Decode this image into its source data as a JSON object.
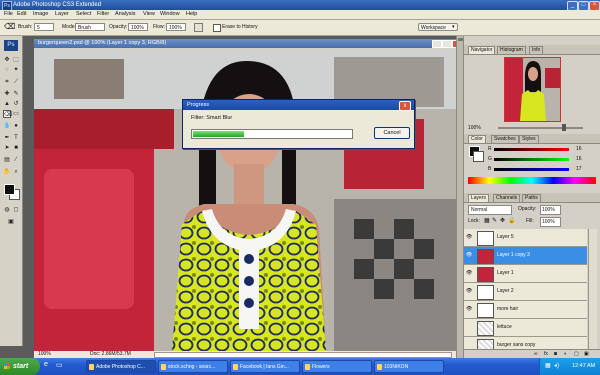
{
  "window": {
    "app_icon": "Ps",
    "title": "Adobe Photoshop CS3 Extended",
    "controls": [
      "_",
      "□",
      "×"
    ]
  },
  "menu": [
    "File",
    "Edit",
    "Image",
    "Layer",
    "Select",
    "Filter",
    "Analysis",
    "View",
    "Window",
    "Help"
  ],
  "options": {
    "brush_label": "Brush:",
    "brush_size": "5",
    "mode_label": "Mode:",
    "mode_value": "Brush",
    "opacity_label": "Opacity:",
    "opacity_value": "100%",
    "flow_label": "Flow:",
    "flow_value": "100%",
    "erase_history_label": "Erase to History",
    "workspace_label": "Workspace"
  },
  "toolbox": {
    "logo": "Ps"
  },
  "document": {
    "title": "burgerqueen2.psd @ 100% (Layer 1 copy 3, RGB/8)",
    "zoom": "100%",
    "doc_size": "Doc: 2.86M/53.7M"
  },
  "progress_dialog": {
    "title": "Progress",
    "label": "Filter: Smart Blur",
    "progress": 0.32,
    "cancel_label": "Cancel",
    "close_glyph": "x"
  },
  "navigator": {
    "tabs": [
      "Navigator",
      "Histogram",
      "Info"
    ],
    "zoom": "100%"
  },
  "color": {
    "tabs": [
      "Color",
      "Swatches",
      "Styles"
    ],
    "r_label": "R",
    "r_value": "16",
    "g_label": "G",
    "g_value": "16",
    "b_label": "B",
    "b_value": "17"
  },
  "layers": {
    "tabs": [
      "Layers",
      "Channels",
      "Paths"
    ],
    "blend_mode": "Normal",
    "opacity_label": "Opacity:",
    "opacity_value": "100%",
    "lock_label": "Lock:",
    "fill_label": "Fill:",
    "fill_value": "100%",
    "items": [
      {
        "name": "Layer 5",
        "visible": true,
        "selected": false
      },
      {
        "name": "Layer 1 copy 3",
        "visible": true,
        "selected": true
      },
      {
        "name": "Layer 1",
        "visible": true,
        "selected": false
      },
      {
        "name": "Layer 2",
        "visible": true,
        "selected": false
      },
      {
        "name": "more hair",
        "visible": true,
        "selected": false
      },
      {
        "name": "lettuce",
        "visible": false,
        "selected": false
      },
      {
        "name": "burger sans copy",
        "visible": false,
        "selected": false
      }
    ]
  },
  "taskbar": {
    "start": "start",
    "tasks": [
      "Adobe Photoshop C...",
      "stock.xchng - searc...",
      "Facebook | Ians Gin...",
      "Flowers",
      "103NIKON"
    ],
    "clock": "12:47 AM"
  },
  "colors": {
    "title_bar": "#1f4d9c",
    "selected_layer": "#3a8ee6",
    "progress_fill": "#1fa81f",
    "dress_yellow": "#d7e61e"
  }
}
